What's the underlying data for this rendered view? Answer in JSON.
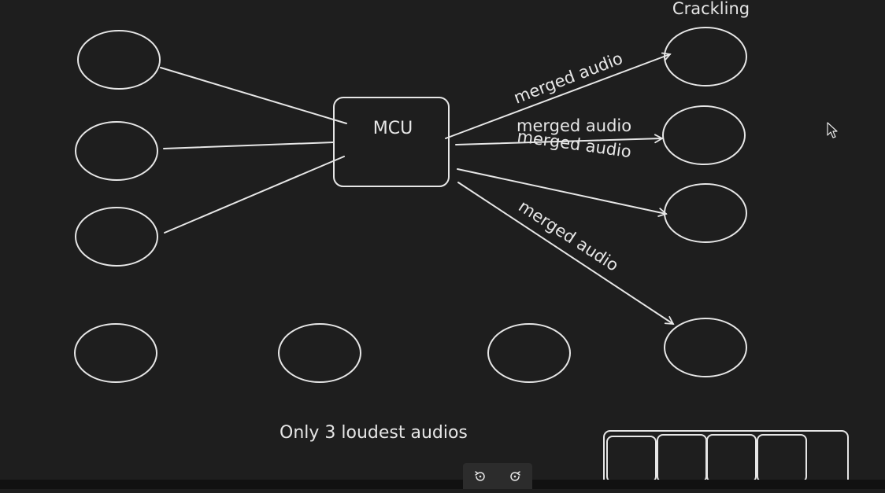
{
  "labels": {
    "mcu": "MCU",
    "crackling": "Crackling",
    "merged_1": "merged audio",
    "merged_2": "merged audio",
    "merged_3": "merged audio",
    "merged_4": "merged audio",
    "footer": "Only 3 loudest audios"
  },
  "icons": {
    "undo": "rotate-left-icon",
    "redo": "rotate-right-icon",
    "cursor": "mouse-pointer-icon"
  },
  "colors": {
    "background": "#1e1e1e",
    "stroke": "#e6e6e6"
  }
}
